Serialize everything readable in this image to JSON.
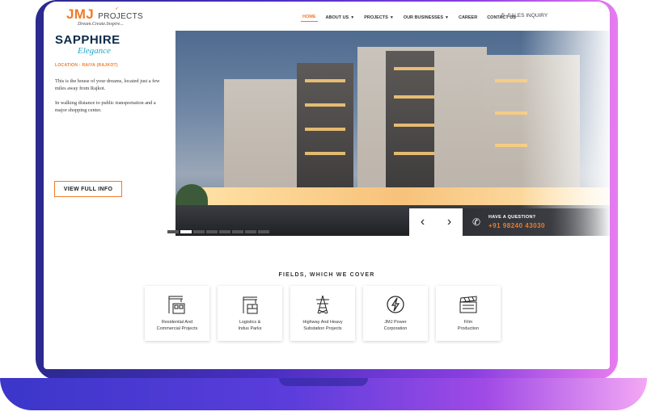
{
  "header": {
    "logo_text": "JMJ",
    "logo_sub": "PROJECTS",
    "logo_tagline": "Dream.Create.Inspire...",
    "nav": [
      {
        "label": "HOME",
        "active": true,
        "caret": false
      },
      {
        "label": "ABOUT US",
        "active": false,
        "caret": true
      },
      {
        "label": "PROJECTS",
        "active": false,
        "caret": true
      },
      {
        "label": "OUR BUSINESSES",
        "active": false,
        "caret": true
      },
      {
        "label": "CAREER",
        "active": false,
        "caret": false
      },
      {
        "label": "CONTACT US",
        "active": false,
        "caret": false
      }
    ],
    "sales_label": "SALES INQUIRY",
    "sales_icon": "phone-icon"
  },
  "hero": {
    "title": "SAPPHIRE",
    "subtitle": "Elegance",
    "location": "LOCATION : RAIYA (RAJKOT)",
    "desc_1": "This is the house of your dreams, located just a few miles away from Rajkot.",
    "desc_2": "In walking distance to public transportation and a major shopping center.",
    "button": "VIEW FULL INFO",
    "prev_icon": "‹",
    "next_icon": "›",
    "question_label": "HAVE A QUESTION?",
    "question_phone": "+91 98240 43030"
  },
  "fields": {
    "title": "FIELDS, WHICH WE COVER",
    "items": [
      {
        "label_1": "Residential And",
        "label_2": "Commercial Projects",
        "icon": "crane-building-icon"
      },
      {
        "label_1": "Logistics &",
        "label_2": "Indus Parks",
        "icon": "logistics-crane-icon"
      },
      {
        "label_1": "Highway And Heavy",
        "label_2": "Substation Projects",
        "icon": "transmission-tower-icon"
      },
      {
        "label_1": "JMJ Power",
        "label_2": "Corporation",
        "icon": "power-bolt-icon"
      },
      {
        "label_1": "Film",
        "label_2": "Production",
        "icon": "clapperboard-icon"
      }
    ]
  },
  "colors": {
    "accent": "#f07a2a",
    "brand_blue": "#0b2b4a",
    "teal": "#20a6c9"
  }
}
